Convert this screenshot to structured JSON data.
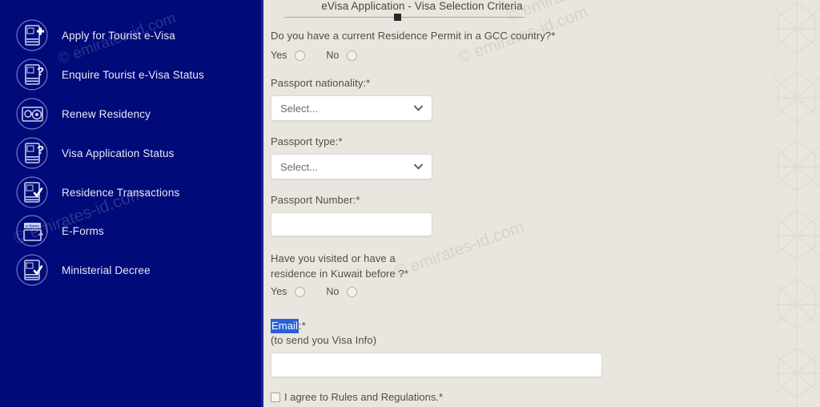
{
  "colors": {
    "sidebar_bg": "#000a78",
    "content_bg": "#e9e6df",
    "selection_blue": "#2b5fd9",
    "field_white": "#ffffff",
    "label_text": "#514e48"
  },
  "sidebar": {
    "items": [
      {
        "label": "Apply for Tourist e-Visa",
        "icon": "document-plus-icon"
      },
      {
        "label": "Enquire Tourist e-Visa Status",
        "icon": "document-question-icon"
      },
      {
        "label": "Renew Residency",
        "icon": "card-search-icon"
      },
      {
        "label": "Visa Application Status",
        "icon": "document-question-icon"
      },
      {
        "label": "Residence Transactions",
        "icon": "document-check-icon"
      },
      {
        "label": "E-Forms",
        "icon": "eforms-icon"
      },
      {
        "label": "Ministerial Decree",
        "icon": "document-check-icon"
      }
    ]
  },
  "form": {
    "title": "eVisa Application - Visa Selection Criteria",
    "gcc_question": {
      "label": "Do you have a current Residence Permit in a GCC country?",
      "required_mark": "*",
      "yes_label": "Yes",
      "no_label": "No",
      "selected": ""
    },
    "passport_nationality": {
      "label": "Passport nationality:",
      "required_mark": "*",
      "value": "Select..."
    },
    "passport_type": {
      "label": "Passport type:",
      "required_mark": "*",
      "value": "Select..."
    },
    "passport_number": {
      "label": "Passport Number:",
      "required_mark": "*",
      "value": ""
    },
    "kuwait_question": {
      "label_line1": "Have you visited or have a",
      "label_line2": "residence in Kuwait before ?",
      "required_mark": "*",
      "yes_label": "Yes",
      "no_label": "No",
      "selected": ""
    },
    "email": {
      "label_highlighted": "Email",
      "label_rest": ":*",
      "hint": "(to send you Visa Info)",
      "value": ""
    },
    "agreement": {
      "label": "I agree to Rules and Regulations.",
      "required_mark": "*",
      "checked": false
    }
  },
  "watermark": {
    "text": "© emirates-id.com"
  }
}
